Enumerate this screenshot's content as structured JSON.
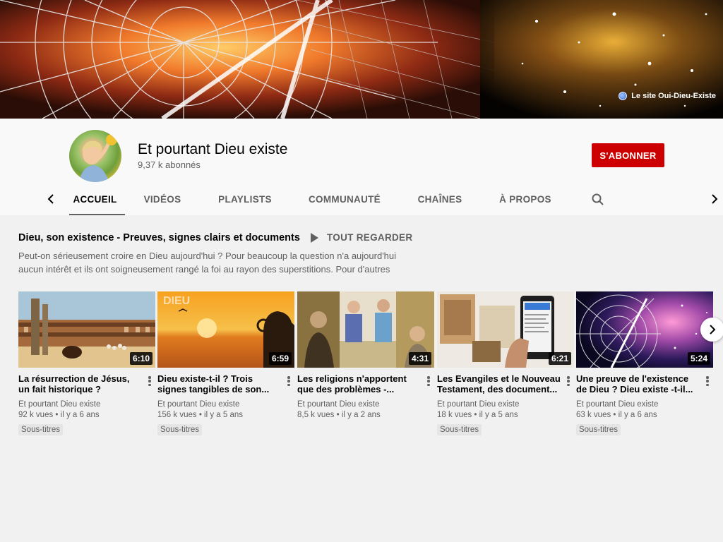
{
  "banner": {
    "link_label": "Le site Oui-Dieu-Existe"
  },
  "channel": {
    "name": "Et pourtant Dieu existe",
    "subscribers": "9,37 k abonnés",
    "subscribe_label": "S'ABONNER"
  },
  "tabs": [
    {
      "label": "ACCUEIL"
    },
    {
      "label": "VIDÉOS"
    },
    {
      "label": "PLAYLISTS"
    },
    {
      "label": "COMMUNAUTÉ"
    },
    {
      "label": "CHAÎNES"
    },
    {
      "label": "À PROPOS"
    }
  ],
  "section": {
    "title": "Dieu, son existence - Preuves, signes clairs et documents",
    "play_all": "TOUT REGARDER",
    "description": "Peut-on sérieusement croire en Dieu aujourd'hui ? Pour beaucoup la question n'a aujourd'hui aucun intérêt et ils ont soigneusement rangé la foi au rayon des superstitions. Pour d'autres"
  },
  "videos": [
    {
      "title": "La résurrection de Jésus, un fait historique ? www.oui-...",
      "duration": "6:10",
      "channel": "Et pourtant Dieu existe",
      "stats": "92 k vues • il y a 6 ans",
      "badge": "Sous-titres"
    },
    {
      "title": "Dieu existe-t-il ? Trois signes tangibles de son...",
      "duration": "6:59",
      "channel": "Et pourtant Dieu existe",
      "stats": "156 k vues • il y a 5 ans",
      "badge": "Sous-titres",
      "thumb_text": "DIEU"
    },
    {
      "title": "Les religions n'apportent que des problèmes -...",
      "duration": "4:31",
      "channel": "Et pourtant Dieu existe",
      "stats": "8,5 k vues • il y a 2 ans",
      "badge": ""
    },
    {
      "title": "Les Evangiles et le Nouveau Testament, des document...",
      "duration": "6:21",
      "channel": "Et pourtant Dieu existe",
      "stats": "18 k vues • il y a 5 ans",
      "badge": "Sous-titres"
    },
    {
      "title": "Une preuve de l'existence de Dieu ? Dieu existe -t-il...",
      "duration": "5:24",
      "channel": "Et pourtant Dieu existe",
      "stats": "63 k vues • il y a 6 ans",
      "badge": "Sous-titres"
    }
  ],
  "colors": {
    "subscribe": "#cc0000",
    "text_secondary": "#606060",
    "page_bg": "#f1f1f1"
  },
  "icons": {
    "prev": "chevron-left-icon",
    "next": "chevron-right-icon",
    "search": "search-icon",
    "play": "play-icon",
    "globe": "globe-icon"
  }
}
